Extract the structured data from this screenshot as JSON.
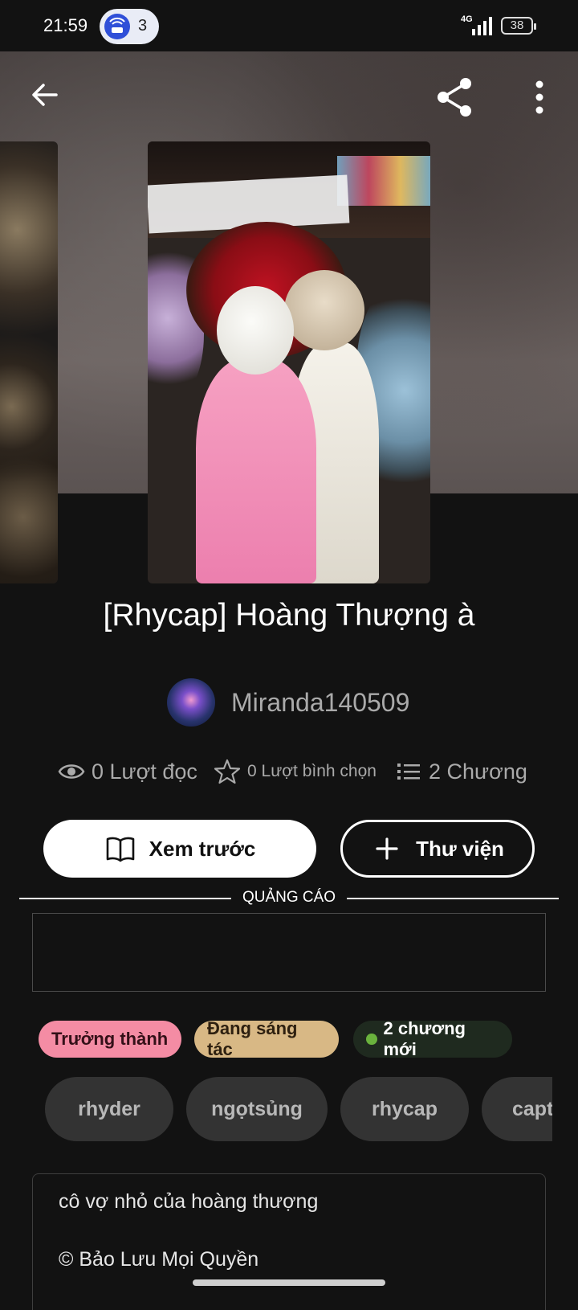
{
  "status_bar": {
    "time": "21:59",
    "notification_count": "3",
    "network": "4G",
    "battery": "38"
  },
  "toolbar": {
    "back_icon": "arrow-left-icon",
    "share_icon": "share-icon",
    "more_icon": "more-vertical-icon"
  },
  "story": {
    "title": "[Rhycap] Hoàng Thượng à",
    "author": "Miranda140509",
    "stats": {
      "reads": "0 Lượt đọc",
      "votes": "0 Lượt bình chọn",
      "chapters": "2 Chương"
    }
  },
  "actions": {
    "preview_label": "Xem trước",
    "library_label": "Thư viện"
  },
  "ad": {
    "label": "QUẢNG CÁO"
  },
  "badges": {
    "mature": "Trưởng thành",
    "ongoing": "Đang sáng tác",
    "new_chapters": "2 chương mới"
  },
  "tags": [
    "rhyder",
    "ngọtsủng",
    "rhycap",
    "capt"
  ],
  "description": {
    "line1": "cô vợ nhỏ của hoàng thượng",
    "line2": "© Bảo Lưu Mọi Quyền"
  },
  "colors": {
    "background": "#121212",
    "mature_badge": "#f48ca4",
    "ongoing_badge": "#d8b885",
    "new_dot": "#6ab23d",
    "tag_bg": "#333333"
  }
}
